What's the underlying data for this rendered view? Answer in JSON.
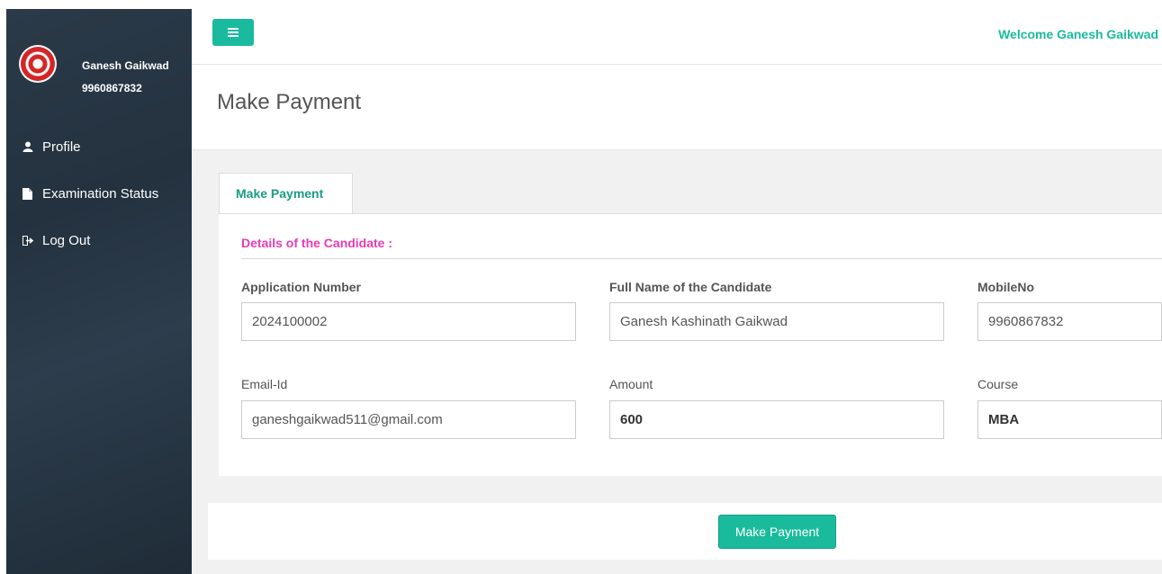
{
  "sidebar": {
    "user_name": "Ganesh Gaikwad",
    "user_phone": "9960867832",
    "items": [
      {
        "label": "Profile",
        "icon": "user-icon"
      },
      {
        "label": "Examination Status",
        "icon": "file-icon"
      },
      {
        "label": "Log Out",
        "icon": "logout-icon"
      }
    ]
  },
  "header": {
    "welcome": "Welcome Ganesh Gaikwad",
    "page_title": "Make Payment"
  },
  "tab": {
    "label": "Make Payment"
  },
  "form": {
    "section_title": "Details of the Candidate :",
    "fields": [
      {
        "label": "Application Number",
        "value": "2024100002"
      },
      {
        "label": "Full Name of the Candidate",
        "value": "Ganesh Kashinath Gaikwad"
      },
      {
        "label": "MobileNo",
        "value": "9960867832"
      },
      {
        "label": "Email-Id",
        "value": "ganeshgaikwad511@gmail.com"
      },
      {
        "label": "Amount",
        "value": "600"
      },
      {
        "label": "Course",
        "value": "MBA"
      }
    ]
  },
  "actions": {
    "pay_label": "Make Payment"
  },
  "colors": {
    "accent": "#1abb9c",
    "sidebar": "#2a3f54",
    "section_heading": "#e83bb4"
  }
}
